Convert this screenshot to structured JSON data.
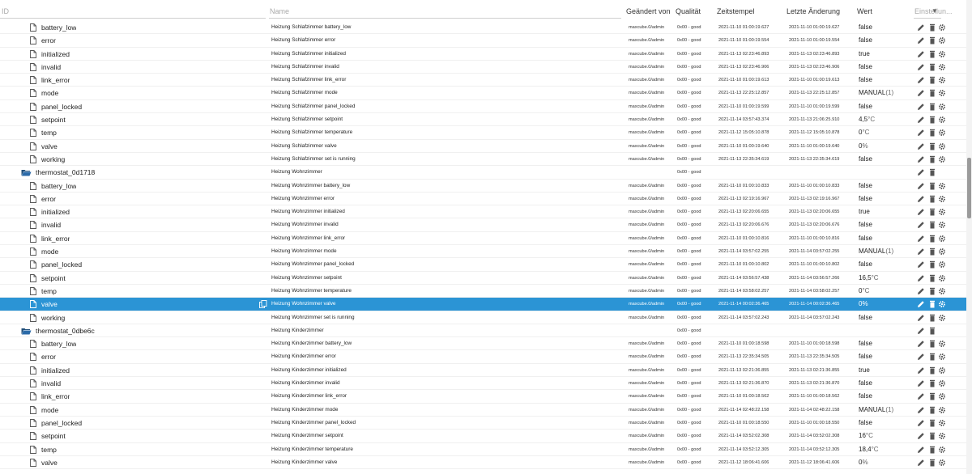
{
  "header": {
    "id_placeholder": "ID",
    "name_placeholder": "Name",
    "changed_by": "Geändert von",
    "quality": "Qualität",
    "timestamp": "Zeitstempel",
    "last_change": "Letzte Änderung",
    "value": "Wert",
    "settings_placeholder": "Einstellun..."
  },
  "colors": {
    "selected": "#2b94d5",
    "icon": "#555555"
  },
  "rows": [
    {
      "type": "state",
      "id": "battery_low",
      "name": "Heizung Schlafzimmer battery_low",
      "changed": "maxcube.0/admin",
      "quality": "0x00 - good",
      "ts": "2021-11-10 01:00:19.627",
      "lc": "2021-11-10 01:00:19.627",
      "value": "false",
      "unit": ""
    },
    {
      "type": "state",
      "id": "error",
      "name": "Heizung Schlafzimmer error",
      "changed": "maxcube.0/admin",
      "quality": "0x00 - good",
      "ts": "2021-11-10 01:00:19.554",
      "lc": "2021-11-10 01:00:19.554",
      "value": "false",
      "unit": ""
    },
    {
      "type": "state",
      "id": "initialized",
      "name": "Heizung Schlafzimmer initialized",
      "changed": "maxcube.0/admin",
      "quality": "0x00 - good",
      "ts": "2021-11-13 02:23:46.893",
      "lc": "2021-11-13 02:23:46.893",
      "value": "true",
      "unit": ""
    },
    {
      "type": "state",
      "id": "invalid",
      "name": "Heizung Schlafzimmer invalid",
      "changed": "maxcube.0/admin",
      "quality": "0x00 - good",
      "ts": "2021-11-13 02:23:46.906",
      "lc": "2021-11-13 02:23:46.906",
      "value": "false",
      "unit": ""
    },
    {
      "type": "state",
      "id": "link_error",
      "name": "Heizung Schlafzimmer link_error",
      "changed": "maxcube.0/admin",
      "quality": "0x00 - good",
      "ts": "2021-11-10 01:00:19.613",
      "lc": "2021-11-10 01:00:19.613",
      "value": "false",
      "unit": ""
    },
    {
      "type": "state",
      "id": "mode",
      "name": "Heizung Schlafzimmer mode",
      "changed": "maxcube.0/admin",
      "quality": "0x00 - good",
      "ts": "2021-11-13 22:25:12.857",
      "lc": "2021-11-13 22:25:12.857",
      "value": "MANUAL",
      "unit": "(1)"
    },
    {
      "type": "state",
      "id": "panel_locked",
      "name": "Heizung Schlafzimmer panel_locked",
      "changed": "maxcube.0/admin",
      "quality": "0x00 - good",
      "ts": "2021-11-10 01:00:19.599",
      "lc": "2021-11-10 01:00:19.599",
      "value": "false",
      "unit": ""
    },
    {
      "type": "state",
      "id": "setpoint",
      "name": "Heizung Schlafzimmer setpoint",
      "changed": "maxcube.0/admin",
      "quality": "0x00 - good",
      "ts": "2021-11-14 03:57:43.374",
      "lc": "2021-11-13 21:06:25.910",
      "value": "4,5",
      "unit": "°C"
    },
    {
      "type": "state",
      "id": "temp",
      "name": "Heizung Schlafzimmer temperature",
      "changed": "maxcube.0/admin",
      "quality": "0x00 - good",
      "ts": "2021-11-12 15:05:10.878",
      "lc": "2021-11-12 15:05:10.878",
      "value": "0",
      "unit": "°C"
    },
    {
      "type": "state",
      "id": "valve",
      "name": "Heizung Schlafzimmer valve",
      "changed": "maxcube.0/admin",
      "quality": "0x00 - good",
      "ts": "2021-11-10 01:00:19.640",
      "lc": "2021-11-10 01:00:19.640",
      "value": "0",
      "unit": "%"
    },
    {
      "type": "state",
      "id": "working",
      "name": "Heizung Schlafzimmer set is running",
      "changed": "maxcube.0/admin",
      "quality": "0x00 - good",
      "ts": "2021-11-13 22:35:34.619",
      "lc": "2021-11-13 22:35:34.619",
      "value": "false",
      "unit": ""
    },
    {
      "type": "folder",
      "id": "thermostat_0d1718",
      "name": "Heizung Wohnzimmer",
      "changed": "",
      "quality": "0x00 - good",
      "ts": "",
      "lc": "",
      "value": "",
      "unit": ""
    },
    {
      "type": "state",
      "id": "battery_low",
      "name": "Heizung Wohnzimmer battery_low",
      "changed": "maxcube.0/admin",
      "quality": "0x00 - good",
      "ts": "2021-11-10 01:00:10.833",
      "lc": "2021-11-10 01:00:10.833",
      "value": "false",
      "unit": ""
    },
    {
      "type": "state",
      "id": "error",
      "name": "Heizung Wohnzimmer error",
      "changed": "maxcube.0/admin",
      "quality": "0x00 - good",
      "ts": "2021-11-13 02:19:16.967",
      "lc": "2021-11-13 02:19:16.967",
      "value": "false",
      "unit": ""
    },
    {
      "type": "state",
      "id": "initialized",
      "name": "Heizung Wohnzimmer initialized",
      "changed": "maxcube.0/admin",
      "quality": "0x00 - good",
      "ts": "2021-11-13 02:20:06.655",
      "lc": "2021-11-13 02:20:06.655",
      "value": "true",
      "unit": ""
    },
    {
      "type": "state",
      "id": "invalid",
      "name": "Heizung Wohnzimmer invalid",
      "changed": "maxcube.0/admin",
      "quality": "0x00 - good",
      "ts": "2021-11-13 02:20:06.676",
      "lc": "2021-11-13 02:20:06.676",
      "value": "false",
      "unit": ""
    },
    {
      "type": "state",
      "id": "link_error",
      "name": "Heizung Wohnzimmer link_error",
      "changed": "maxcube.0/admin",
      "quality": "0x00 - good",
      "ts": "2021-11-10 01:00:10.816",
      "lc": "2021-11-10 01:00:10.816",
      "value": "false",
      "unit": ""
    },
    {
      "type": "state",
      "id": "mode",
      "name": "Heizung Wohnzimmer mode",
      "changed": "maxcube.0/admin",
      "quality": "0x00 - good",
      "ts": "2021-11-14 03:57:02.255",
      "lc": "2021-11-14 03:57:02.255",
      "value": "MANUAL",
      "unit": "(1)"
    },
    {
      "type": "state",
      "id": "panel_locked",
      "name": "Heizung Wohnzimmer panel_locked",
      "changed": "maxcube.0/admin",
      "quality": "0x00 - good",
      "ts": "2021-11-10 01:00:10.802",
      "lc": "2021-11-10 01:00:10.802",
      "value": "false",
      "unit": ""
    },
    {
      "type": "state",
      "id": "setpoint",
      "name": "Heizung Wohnzimmer setpoint",
      "changed": "maxcube.0/admin",
      "quality": "0x00 - good",
      "ts": "2021-11-14 03:56:57.438",
      "lc": "2021-11-14 03:56:57.266",
      "value": "16,5",
      "unit": "°C"
    },
    {
      "type": "state",
      "id": "temp",
      "name": "Heizung Wohnzimmer temperature",
      "changed": "maxcube.0/admin",
      "quality": "0x00 - good",
      "ts": "2021-11-14 03:58:02.257",
      "lc": "2021-11-14 03:58:02.257",
      "value": "0",
      "unit": "°C"
    },
    {
      "type": "state",
      "id": "valve",
      "name": "Heizung Wohnzimmer valve",
      "changed": "maxcube.0/admin",
      "quality": "0x00 - good",
      "ts": "2021-11-14 00:02:36.465",
      "lc": "2021-11-14 00:02:36.465",
      "value": "0",
      "unit": "%",
      "selected": true
    },
    {
      "type": "state",
      "id": "working",
      "name": "Heizung Wohnzimmer set is running",
      "changed": "maxcube.0/admin",
      "quality": "0x00 - good",
      "ts": "2021-11-14 03:57:02.243",
      "lc": "2021-11-14 03:57:02.243",
      "value": "false",
      "unit": ""
    },
    {
      "type": "folder",
      "id": "thermostat_0dbe6c",
      "name": "Heizung Kinderzimmer",
      "changed": "",
      "quality": "0x00 - good",
      "ts": "",
      "lc": "",
      "value": "",
      "unit": ""
    },
    {
      "type": "state",
      "id": "battery_low",
      "name": "Heizung Kinderzimmer battery_low",
      "changed": "maxcube.0/admin",
      "quality": "0x00 - good",
      "ts": "2021-11-10 01:00:18.598",
      "lc": "2021-11-10 01:00:18.598",
      "value": "false",
      "unit": ""
    },
    {
      "type": "state",
      "id": "error",
      "name": "Heizung Kinderzimmer error",
      "changed": "maxcube.0/admin",
      "quality": "0x00 - good",
      "ts": "2021-11-13 22:35:34.505",
      "lc": "2021-11-13 22:35:34.505",
      "value": "false",
      "unit": ""
    },
    {
      "type": "state",
      "id": "initialized",
      "name": "Heizung Kinderzimmer initialized",
      "changed": "maxcube.0/admin",
      "quality": "0x00 - good",
      "ts": "2021-11-13 02:21:36.855",
      "lc": "2021-11-13 02:21:36.855",
      "value": "true",
      "unit": ""
    },
    {
      "type": "state",
      "id": "invalid",
      "name": "Heizung Kinderzimmer invalid",
      "changed": "maxcube.0/admin",
      "quality": "0x00 - good",
      "ts": "2021-11-13 02:21:36.870",
      "lc": "2021-11-13 02:21:36.870",
      "value": "false",
      "unit": ""
    },
    {
      "type": "state",
      "id": "link_error",
      "name": "Heizung Kinderzimmer link_error",
      "changed": "maxcube.0/admin",
      "quality": "0x00 - good",
      "ts": "2021-11-10 01:00:18.562",
      "lc": "2021-11-10 01:00:18.562",
      "value": "false",
      "unit": ""
    },
    {
      "type": "state",
      "id": "mode",
      "name": "Heizung Kinderzimmer mode",
      "changed": "maxcube.0/admin",
      "quality": "0x00 - good",
      "ts": "2021-11-14 02:48:22.158",
      "lc": "2021-11-14 02:48:22.158",
      "value": "MANUAL",
      "unit": "(1)"
    },
    {
      "type": "state",
      "id": "panel_locked",
      "name": "Heizung Kinderzimmer panel_locked",
      "changed": "maxcube.0/admin",
      "quality": "0x00 - good",
      "ts": "2021-11-10 01:00:18.550",
      "lc": "2021-11-10 01:00:18.550",
      "value": "false",
      "unit": ""
    },
    {
      "type": "state",
      "id": "setpoint",
      "name": "Heizung Kinderzimmer setpoint",
      "changed": "maxcube.0/admin",
      "quality": "0x00 - good",
      "ts": "2021-11-14 03:52:02.308",
      "lc": "2021-11-14 03:52:02.308",
      "value": "16",
      "unit": "°C"
    },
    {
      "type": "state",
      "id": "temp",
      "name": "Heizung Kinderzimmer temperature",
      "changed": "maxcube.0/admin",
      "quality": "0x00 - good",
      "ts": "2021-11-14 03:52:12.305",
      "lc": "2021-11-14 03:52:12.305",
      "value": "18,4",
      "unit": "°C"
    },
    {
      "type": "state",
      "id": "valve",
      "name": "Heizung Kinderzimmer valve",
      "changed": "maxcube.0/admin",
      "quality": "0x00 - good",
      "ts": "2021-11-12 18:06:41.606",
      "lc": "2021-11-12 18:06:41.606",
      "value": "0",
      "unit": "%"
    }
  ]
}
